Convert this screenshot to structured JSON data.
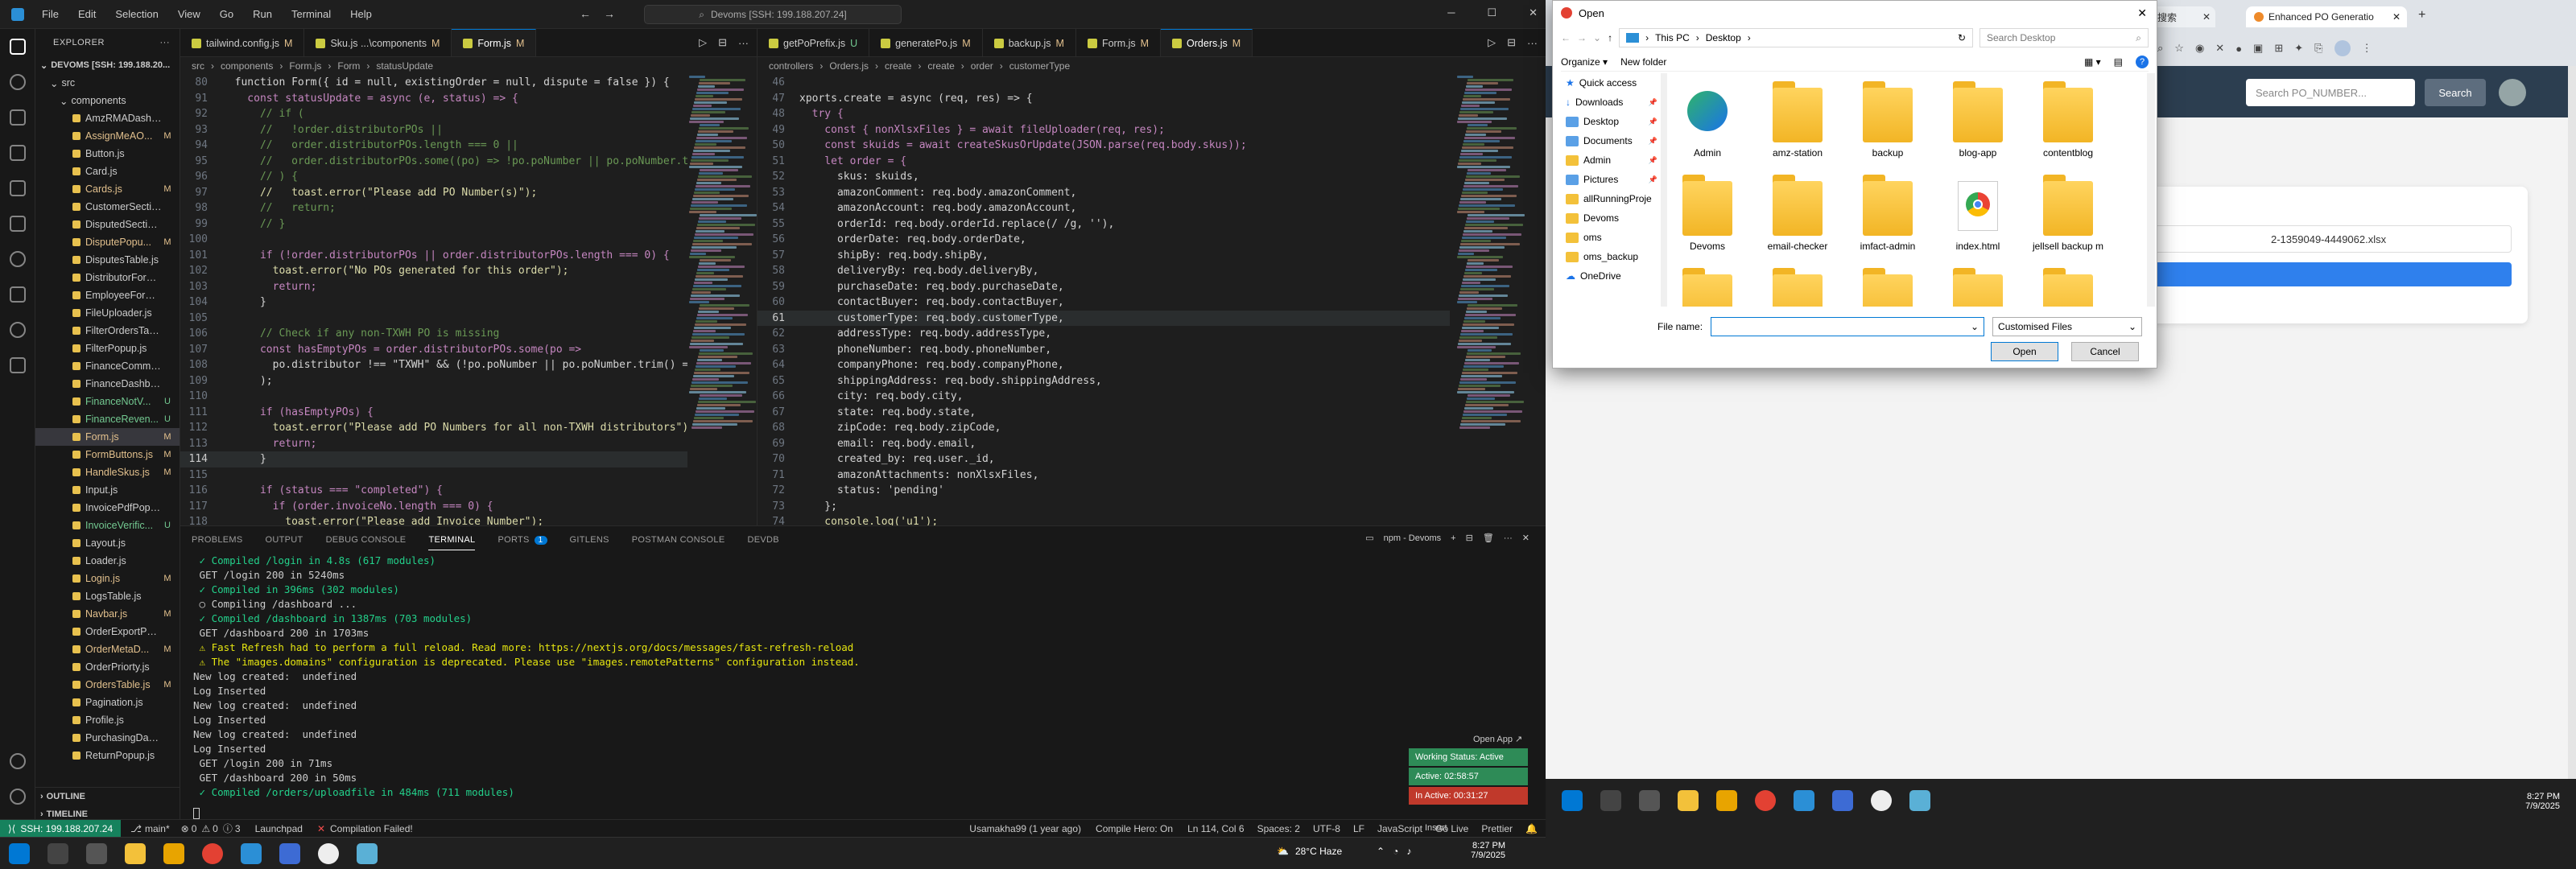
{
  "vscode": {
    "menu": [
      "File",
      "Edit",
      "Selection",
      "View",
      "Go",
      "Run",
      "Terminal",
      "Help"
    ],
    "command_center": "Devoms [SSH: 199.188.207.24]",
    "explorer": {
      "header": "EXPLORER",
      "root": "DEVOMS [SSH: 199.188.20...",
      "src": "src",
      "components": "components",
      "files": [
        {
          "name": "AmzRMADashboar...",
          "status": "",
          "cls": "norm"
        },
        {
          "name": "AssignMeAO...",
          "status": "M",
          "cls": "mod"
        },
        {
          "name": "Button.js",
          "status": "",
          "cls": "norm"
        },
        {
          "name": "Card.js",
          "status": "",
          "cls": "norm"
        },
        {
          "name": "Cards.js",
          "status": "M",
          "cls": "mod"
        },
        {
          "name": "CustomerSection.js",
          "status": "",
          "cls": "norm"
        },
        {
          "name": "DisputedSection.js",
          "status": "",
          "cls": "norm"
        },
        {
          "name": "DisputePopu...",
          "status": "M",
          "cls": "mod"
        },
        {
          "name": "DisputesTable.js",
          "status": "",
          "cls": "norm"
        },
        {
          "name": "DistributorForm.js",
          "status": "",
          "cls": "norm"
        },
        {
          "name": "EmployeeForm.js",
          "status": "",
          "cls": "norm"
        },
        {
          "name": "FileUploader.js",
          "status": "",
          "cls": "norm"
        },
        {
          "name": "FilterOrdersTable.js",
          "status": "",
          "cls": "norm"
        },
        {
          "name": "FilterPopup.js",
          "status": "",
          "cls": "norm"
        },
        {
          "name": "FinanceComments.js",
          "status": "",
          "cls": "norm"
        },
        {
          "name": "FinanceDashboard.js",
          "status": "",
          "cls": "norm"
        },
        {
          "name": "FinanceNotV...",
          "status": "U",
          "cls": "unt"
        },
        {
          "name": "FinanceReven...",
          "status": "U",
          "cls": "unt"
        },
        {
          "name": "Form.js",
          "status": "M",
          "cls": "mod"
        },
        {
          "name": "FormButtons.js",
          "status": "M",
          "cls": "mod"
        },
        {
          "name": "HandleSkus.js",
          "status": "M",
          "cls": "mod"
        },
        {
          "name": "Input.js",
          "status": "",
          "cls": "norm"
        },
        {
          "name": "InvoicePdfPopup.js",
          "status": "",
          "cls": "norm"
        },
        {
          "name": "InvoiceVerific...",
          "status": "U",
          "cls": "unt"
        },
        {
          "name": "Layout.js",
          "status": "",
          "cls": "norm"
        },
        {
          "name": "Loader.js",
          "status": "",
          "cls": "norm"
        },
        {
          "name": "Login.js",
          "status": "M",
          "cls": "mod"
        },
        {
          "name": "LogsTable.js",
          "status": "",
          "cls": "norm"
        },
        {
          "name": "Navbar.js",
          "status": "M",
          "cls": "mod"
        },
        {
          "name": "OrderExportPopup.js",
          "status": "",
          "cls": "norm"
        },
        {
          "name": "OrderMetaD...",
          "status": "M",
          "cls": "mod"
        },
        {
          "name": "OrderPriorty.js",
          "status": "",
          "cls": "norm"
        },
        {
          "name": "OrdersTable.js",
          "status": "M",
          "cls": "mod"
        },
        {
          "name": "Pagination.js",
          "status": "",
          "cls": "norm"
        },
        {
          "name": "Profile.js",
          "status": "",
          "cls": "norm"
        },
        {
          "name": "PurchasingDashbo...",
          "status": "",
          "cls": "norm"
        },
        {
          "name": "ReturnPopup.js",
          "status": "",
          "cls": "norm"
        }
      ],
      "outline": "OUTLINE",
      "timeline": "TIMELINE"
    },
    "left_tabs": [
      {
        "label": "tailwind.config.js",
        "badge": "M"
      },
      {
        "label": "Sku.js ...\\components",
        "badge": "M"
      },
      {
        "label": "Form.js",
        "badge": "M",
        "active": true
      }
    ],
    "right_tabs": [
      {
        "label": "getPoPrefix.js",
        "badge": "U"
      },
      {
        "label": "generatePo.js",
        "badge": "M"
      },
      {
        "label": "backup.js",
        "badge": "M"
      },
      {
        "label": "Form.js",
        "badge": "M"
      },
      {
        "label": "Orders.js",
        "badge": "M",
        "active": true
      }
    ],
    "left_breadcrumb": [
      "src",
      "components",
      "Form.js",
      "Form",
      "statusUpdate"
    ],
    "right_breadcrumb": [
      "controllers",
      "Orders.js",
      "create",
      "create",
      "order",
      "customerType"
    ],
    "left_code": [
      {
        "n": "80",
        "t": "  function Form({ id = null, existingOrder = null, dispute = false }) {"
      },
      {
        "n": "91",
        "t": "    const statusUpdate = async (e, status) => {"
      },
      {
        "n": "92",
        "t": "      // if ("
      },
      {
        "n": "93",
        "t": "      //   !order.distributorPOs ||"
      },
      {
        "n": "94",
        "t": "      //   order.distributorPOs.length === 0 ||"
      },
      {
        "n": "95",
        "t": "      //   order.distributorPOs.some((po) => !po.poNumber || po.poNumber.tri"
      },
      {
        "n": "96",
        "t": "      // ) {"
      },
      {
        "n": "97",
        "t": "      //   toast.error(\"Please add PO Number(s)\");"
      },
      {
        "n": "98",
        "t": "      //   return;"
      },
      {
        "n": "99",
        "t": "      // }"
      },
      {
        "n": "100",
        "t": ""
      },
      {
        "n": "101",
        "t": "      if (!order.distributorPOs || order.distributorPOs.length === 0) {"
      },
      {
        "n": "102",
        "t": "        toast.error(\"No POs generated for this order\");"
      },
      {
        "n": "103",
        "t": "        return;"
      },
      {
        "n": "104",
        "t": "      }"
      },
      {
        "n": "105",
        "t": ""
      },
      {
        "n": "106",
        "t": "      // Check if any non-TXWH PO is missing"
      },
      {
        "n": "107",
        "t": "      const hasEmptyPOs = order.distributorPOs.some(po =>"
      },
      {
        "n": "108",
        "t": "        po.distributor !== \"TXWH\" && (!po.poNumber || po.poNumber.trim() ="
      },
      {
        "n": "109",
        "t": "      );"
      },
      {
        "n": "110",
        "t": ""
      },
      {
        "n": "111",
        "t": "      if (hasEmptyPOs) {"
      },
      {
        "n": "112",
        "t": "        toast.error(\"Please add PO Numbers for all non-TXWH distributors\")"
      },
      {
        "n": "113",
        "t": "        return;"
      },
      {
        "n": "114",
        "t": "      }"
      },
      {
        "n": "115",
        "t": ""
      },
      {
        "n": "116",
        "t": "      if (status === \"completed\") {"
      },
      {
        "n": "117",
        "t": "        if (order.invoiceNo.length === 0) {"
      },
      {
        "n": "118",
        "t": "          toast.error(\"Please add Invoice Number\");"
      },
      {
        "n": "119",
        "t": "          return;"
      }
    ],
    "right_code": [
      {
        "n": "46",
        "t": ""
      },
      {
        "n": "47",
        "t": "xports.create = async (req, res) => {"
      },
      {
        "n": "48",
        "t": "  try {"
      },
      {
        "n": "49",
        "t": "    const { nonXlsxFiles } = await fileUploader(req, res);"
      },
      {
        "n": "50",
        "t": "    const skuids = await createSkusOrUpdate(JSON.parse(req.body.skus));"
      },
      {
        "n": "51",
        "t": "    let order = {"
      },
      {
        "n": "52",
        "t": "      skus: skuids,"
      },
      {
        "n": "53",
        "t": "      amazonComment: req.body.amazonComment,"
      },
      {
        "n": "54",
        "t": "      amazonAccount: req.body.amazonAccount,"
      },
      {
        "n": "55",
        "t": "      orderId: req.body.orderId.replace(/ /g, ''),"
      },
      {
        "n": "56",
        "t": "      orderDate: req.body.orderDate,"
      },
      {
        "n": "57",
        "t": "      shipBy: req.body.shipBy,"
      },
      {
        "n": "58",
        "t": "      deliveryBy: req.body.deliveryBy,"
      },
      {
        "n": "59",
        "t": "      purchaseDate: req.body.purchaseDate,"
      },
      {
        "n": "60",
        "t": "      contactBuyer: req.body.contactBuyer,"
      },
      {
        "n": "61",
        "t": "      customerType: req.body.customerType,"
      },
      {
        "n": "62",
        "t": "      addressType: req.body.addressType,"
      },
      {
        "n": "63",
        "t": "      phoneNumber: req.body.phoneNumber,"
      },
      {
        "n": "64",
        "t": "      companyPhone: req.body.companyPhone,"
      },
      {
        "n": "65",
        "t": "      shippingAddress: req.body.shippingAddress,"
      },
      {
        "n": "66",
        "t": "      city: req.body.city,"
      },
      {
        "n": "67",
        "t": "      state: req.body.state,"
      },
      {
        "n": "68",
        "t": "      zipCode: req.body.zipCode,"
      },
      {
        "n": "69",
        "t": "      email: req.body.email,"
      },
      {
        "n": "70",
        "t": "      created_by: req.user._id,"
      },
      {
        "n": "71",
        "t": "      amazonAttachments: nonXlsxFiles,"
      },
      {
        "n": "72",
        "t": "      status: 'pending'"
      },
      {
        "n": "73",
        "t": "    };"
      },
      {
        "n": "74",
        "t": "    console.log('u1');"
      }
    ],
    "panel_tabs": [
      "PROBLEMS",
      "OUTPUT",
      "DEBUG CONSOLE",
      "TERMINAL",
      "PORTS",
      "GITLENS",
      "POSTMAN CONSOLE",
      "DEVDB"
    ],
    "ports_badge": "1",
    "terminal_label": "npm - Devoms",
    "terminal": [
      {
        "c": "g",
        "t": " ✓ Compiled /login in 4.8s (617 modules)"
      },
      {
        "c": "w",
        "t": " GET /login 200 in 5240ms"
      },
      {
        "c": "g",
        "t": " ✓ Compiled in 396ms (302 modules)"
      },
      {
        "c": "w",
        "t": " ○ Compiling /dashboard ..."
      },
      {
        "c": "g",
        "t": " ✓ Compiled /dashboard in 1387ms (703 modules)"
      },
      {
        "c": "w",
        "t": " GET /dashboard 200 in 1703ms"
      },
      {
        "c": "y",
        "t": " ⚠ Fast Refresh had to perform a full reload. Read more: https://nextjs.org/docs/messages/fast-refresh-reload"
      },
      {
        "c": "y",
        "t": " ⚠ The \"images.domains\" configuration is deprecated. Please use \"images.remotePatterns\" configuration instead."
      },
      {
        "c": "w",
        "t": "New log created:  undefined"
      },
      {
        "c": "w",
        "t": "Log Inserted"
      },
      {
        "c": "w",
        "t": "New log created:  undefined"
      },
      {
        "c": "w",
        "t": "Log Inserted"
      },
      {
        "c": "w",
        "t": "New log created:  undefined"
      },
      {
        "c": "w",
        "t": "Log Inserted"
      },
      {
        "c": "w",
        "t": " GET /login 200 in 71ms"
      },
      {
        "c": "w",
        "t": " GET /dashboard 200 in 50ms"
      },
      {
        "c": "g",
        "t": " ✓ Compiled /orders/uploadfile in 484ms (711 modules)"
      }
    ],
    "open_app": "Open App ↗",
    "working_status": "Working Status: Active",
    "active_time": "Active: 02:58:57",
    "inactive_time": "In Active: 00:31:27",
    "statusbar": {
      "remote": "SSH: 199.188.207.24",
      "branch": "main*",
      "errors": "0",
      "warnings": "0",
      "info": "3",
      "launchpad": "Launchpad",
      "compile": "Compilation Failed!",
      "blame": "Usamakha99 (1 year ago)",
      "hero": "Compile Hero: On",
      "position": "Ln 114, Col 6",
      "spaces": "Spaces: 2",
      "encoding": "UTF-8",
      "eol": "LF",
      "lang": "JavaScript",
      "golive": "Go Live",
      "prettier": "Prettier"
    },
    "weather": "28°C  Haze",
    "insert": "Insert",
    "time": "8:27 PM",
    "date": "7/9/2025"
  },
  "browser": {
    "tab1": "Enhanced PO Generatio",
    "tab_cn": "搜索",
    "search_placeholder": "Search PO_NUMBER...",
    "search_button": "Search",
    "file_chip": "2-1359049-4449062.xlsx"
  },
  "dialog": {
    "title": "Open",
    "path": [
      "This PC",
      "Desktop"
    ],
    "search_placeholder": "Search Desktop",
    "organize": "Organize",
    "new_folder": "New folder",
    "nav": [
      "Quick access",
      "Downloads",
      "Desktop",
      "Documents",
      "Admin",
      "Pictures",
      "allRunningProje",
      "Devoms",
      "oms",
      "oms_backup",
      "OneDrive"
    ],
    "files": [
      "Admin",
      "amz-station",
      "backup",
      "blog-app",
      "contentblog",
      "Devoms",
      "email-checker",
      "imfact-admin",
      "index.html",
      "jellsell backup m"
    ],
    "filename_label": "File name:",
    "filename_value": "",
    "filetype": "Customised Files",
    "open": "Open",
    "cancel": "Cancel"
  }
}
